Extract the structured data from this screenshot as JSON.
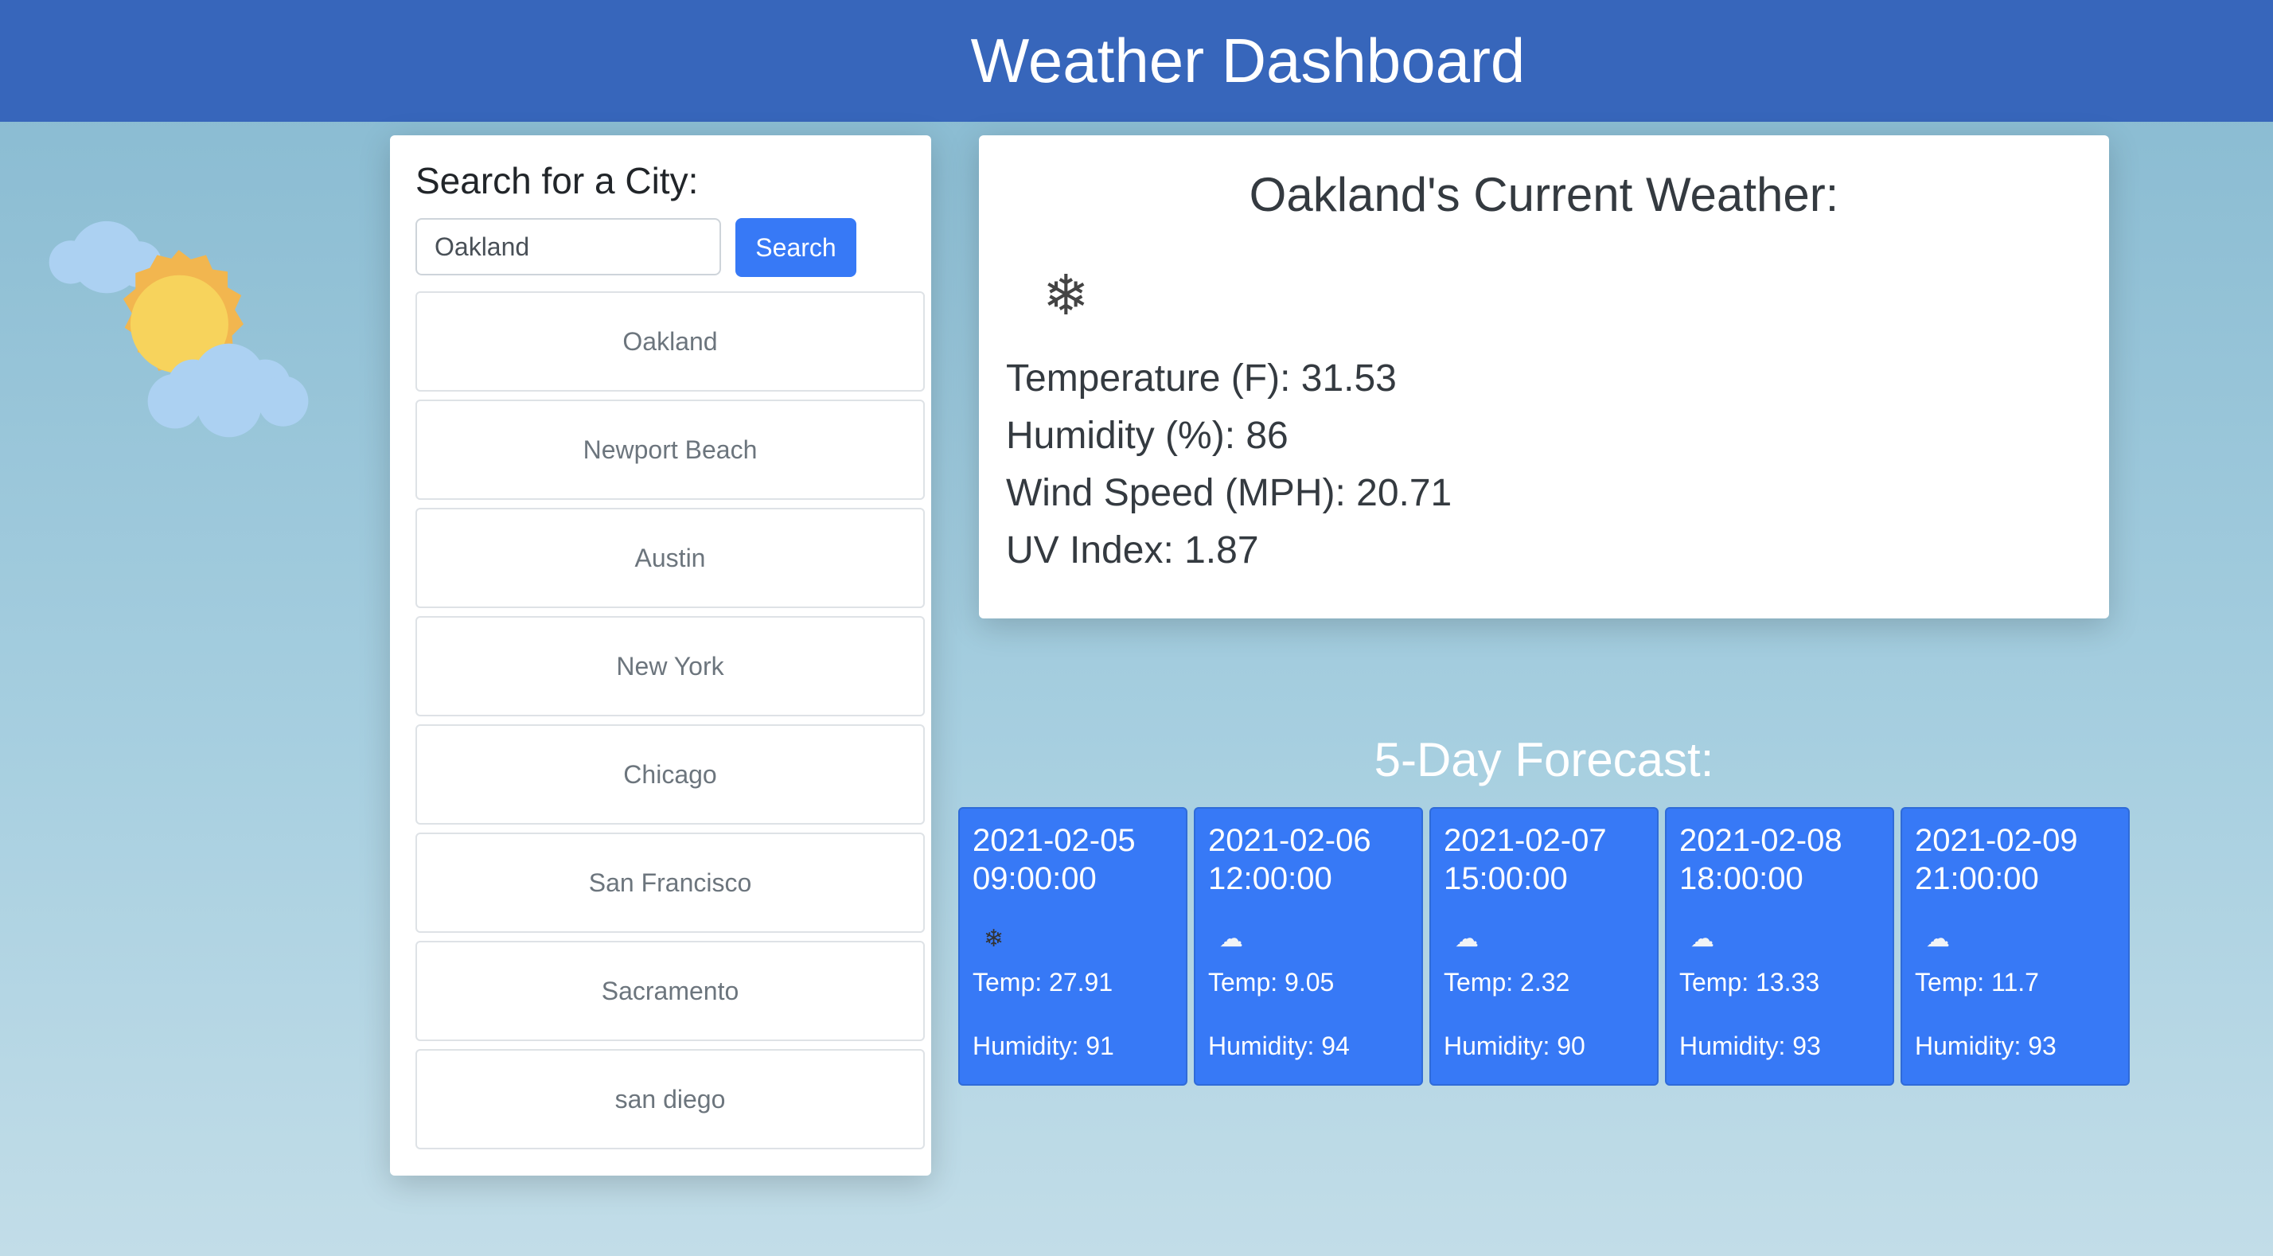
{
  "header": {
    "title": "Weather Dashboard"
  },
  "logo": {
    "icon": "sun-behind-clouds-icon"
  },
  "search": {
    "title": "Search for a City:",
    "input_value": "Oakland",
    "button_label": "Search",
    "history": [
      "Oakland",
      "Newport Beach",
      "Austin",
      "New York",
      "Chicago",
      "San Francisco",
      "Sacramento",
      "san diego"
    ]
  },
  "current": {
    "title": "Oakland's Current Weather:",
    "icon": "snowflake-icon",
    "icon_glyph": "❄",
    "temperature": "Temperature (F): 31.53",
    "humidity": "Humidity (%): 86",
    "wind": "Wind Speed (MPH): 20.71",
    "uv": "UV Index: 1.87"
  },
  "forecast": {
    "title": "5-Day Forecast:",
    "days": [
      {
        "date": "2021-02-05",
        "time": "09:00:00",
        "icon": "snowflake-icon",
        "glyph": "❄",
        "temp": "Temp: 27.91",
        "humidity": "Humidity: 91"
      },
      {
        "date": "2021-02-06",
        "time": "12:00:00",
        "icon": "cloud-icon",
        "glyph": "☁",
        "temp": "Temp: 9.05",
        "humidity": "Humidity: 94"
      },
      {
        "date": "2021-02-07",
        "time": "15:00:00",
        "icon": "cloud-icon",
        "glyph": "☁",
        "temp": "Temp: 2.32",
        "humidity": "Humidity: 90"
      },
      {
        "date": "2021-02-08",
        "time": "18:00:00",
        "icon": "cloud-icon",
        "glyph": "☁",
        "temp": "Temp: 13.33",
        "humidity": "Humidity: 93"
      },
      {
        "date": "2021-02-09",
        "time": "21:00:00",
        "icon": "cloud-icon",
        "glyph": "☁",
        "temp": "Temp: 11.7",
        "humidity": "Humidity: 93"
      }
    ]
  },
  "colors": {
    "header": "#3766bb",
    "accent": "#3779f6"
  }
}
